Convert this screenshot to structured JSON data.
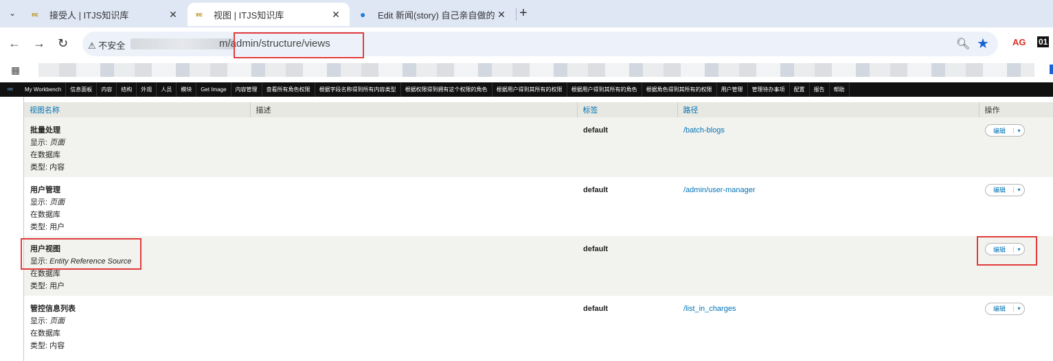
{
  "browser": {
    "tabs": [
      {
        "title": "接受人 | ITJS知识库",
        "favicon": "site-logo"
      },
      {
        "title": "视图 | ITJS知识库",
        "favicon": "site-logo",
        "active": true
      },
      {
        "title": "Edit 新闻(story) 自己亲自做的",
        "favicon": "drupal-drop"
      }
    ],
    "security_label": "不安全",
    "url_visible": "m/admin/structure/views",
    "ext1": "AG",
    "ext2": "01"
  },
  "adminbar": {
    "items": [
      "My Workbench",
      "信息面板",
      "内容",
      "结构",
      "外观",
      "人员",
      "模块",
      "Get Image",
      "内容管理",
      "查看所有角色权限",
      "根据字段名称得到所有内容类型",
      "根据权限得到拥有这个权限的角色",
      "根据用户得到其所有的权限",
      "根据用户得到其所有的角色",
      "根据角色得到其所有的权限",
      "用户管理",
      "管理待办事项",
      "配置",
      "报告",
      "帮助"
    ]
  },
  "table": {
    "headers": {
      "name": "视图名称",
      "description": "描述",
      "tag": "标签",
      "path": "路径",
      "operations": "操作"
    },
    "rows": [
      {
        "name": "批量处理",
        "display_label": "显示:",
        "display": "页面",
        "storage": "在数据库",
        "type": "类型: 内容",
        "tag": "default",
        "path": "/batch-blogs",
        "op": "编辑"
      },
      {
        "name": "用户管理",
        "display_label": "显示:",
        "display": "页面",
        "storage": "在数据库",
        "type": "类型: 用户",
        "tag": "default",
        "path": "/admin/user-manager",
        "op": "编辑"
      },
      {
        "name": "用户视图",
        "display_label": "显示:",
        "display": "Entity Reference Source",
        "storage": "在数据库",
        "type": "类型: 用户",
        "tag": "default",
        "path": "",
        "op": "编辑"
      },
      {
        "name": "管控信息列表",
        "display_label": "显示:",
        "display": "页面",
        "storage": "在数据库",
        "type": "类型: 内容",
        "tag": "default",
        "path": "/list_in_charges",
        "op": "编辑"
      }
    ]
  },
  "colors": {
    "link": "#0073b6",
    "highlight": "#e03a3a",
    "star": "#1a63d6"
  }
}
